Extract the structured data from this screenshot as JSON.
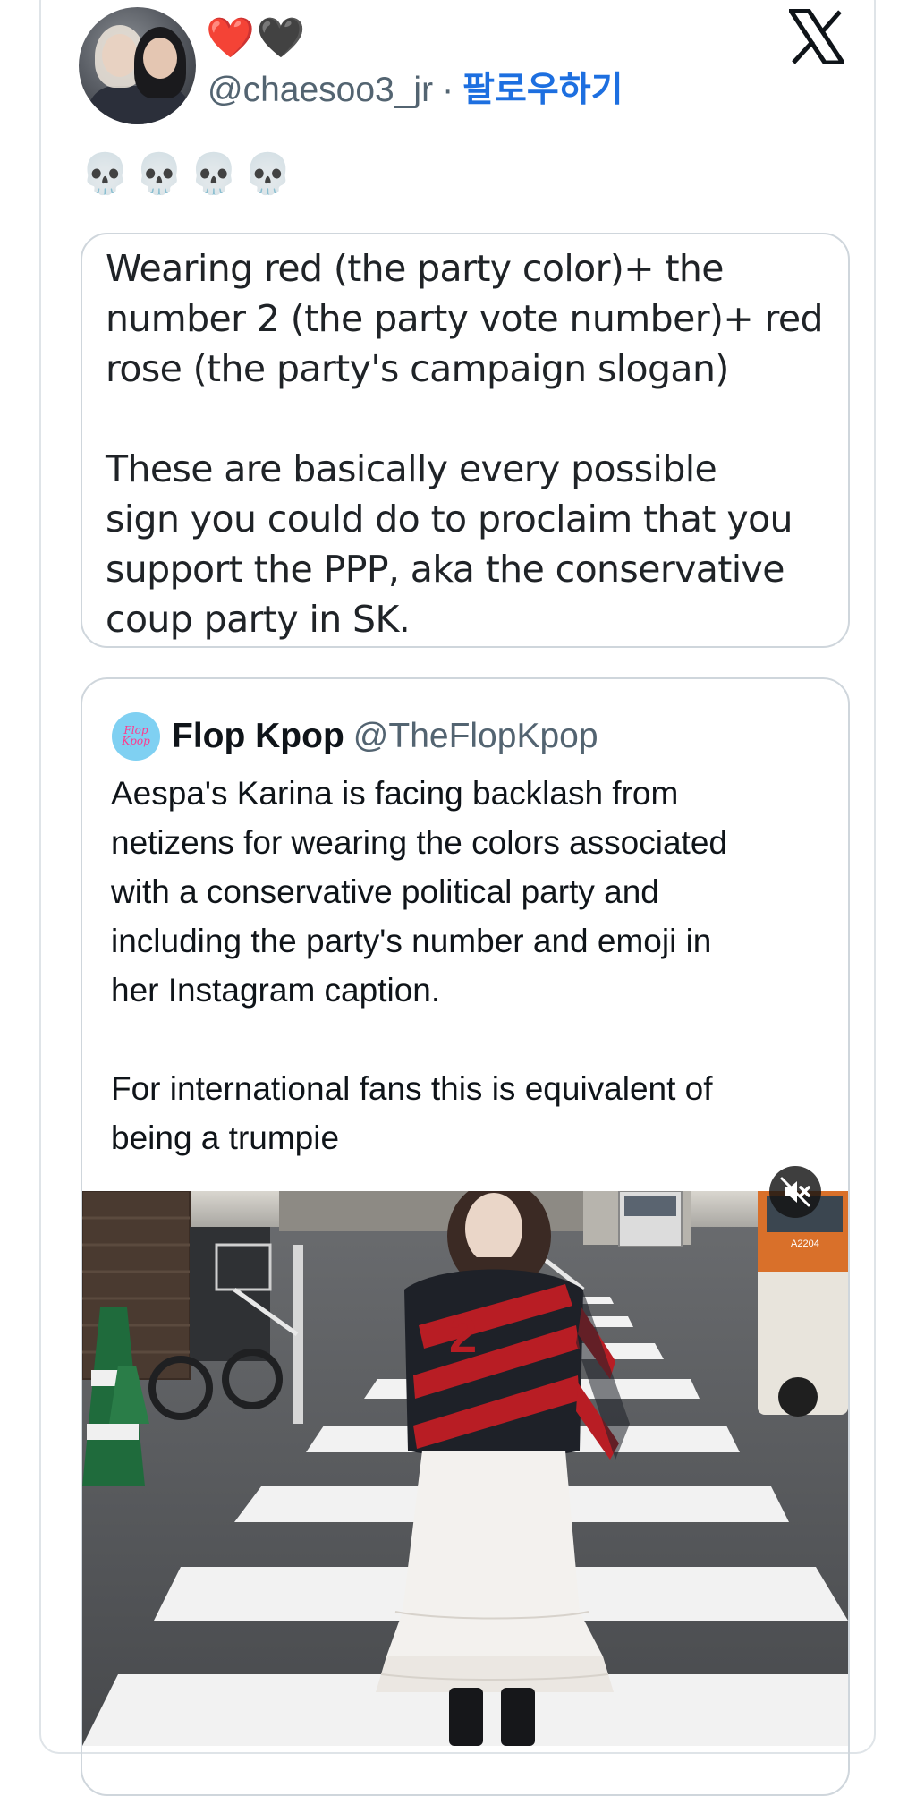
{
  "tweet": {
    "emojis": [
      "❤️",
      "🖤"
    ],
    "handle": "@chaesoo3_jr",
    "separator": "·",
    "follow_label": "팔로우하기",
    "skulls": "💀💀💀💀",
    "quote_box_lines": [
      "Wearing red (the party color)+ the",
      "number 2 (the party vote number)+ red",
      "rose (the party's campaign slogan)",
      "These are basically every possible",
      "sign you could do to proclaim that you",
      "support the PPP, aka the conservative",
      "coup party in SK."
    ]
  },
  "quoted_tweet": {
    "logo_text": [
      "Flop",
      "Kpop"
    ],
    "name": "Flop Kpop",
    "handle": "@TheFlopKpop",
    "lines": [
      "Aespa's Karina is facing backlash from",
      "netizens for wearing the colors associated",
      "with a conservative political party and",
      "including the party's number and emoji in",
      "her Instagram caption.",
      "For international fans this is equivalent of",
      "being a trumpie"
    ],
    "photo_bus_number": "A2204"
  },
  "icons": {
    "x_logo": "x-logo-icon",
    "mute": "speaker-muted-icon"
  },
  "colors": {
    "follow_blue": "#1d6fe0",
    "muted_gray": "#536471",
    "border": "#cfd6dc",
    "jacket_red": "#b81d24"
  }
}
